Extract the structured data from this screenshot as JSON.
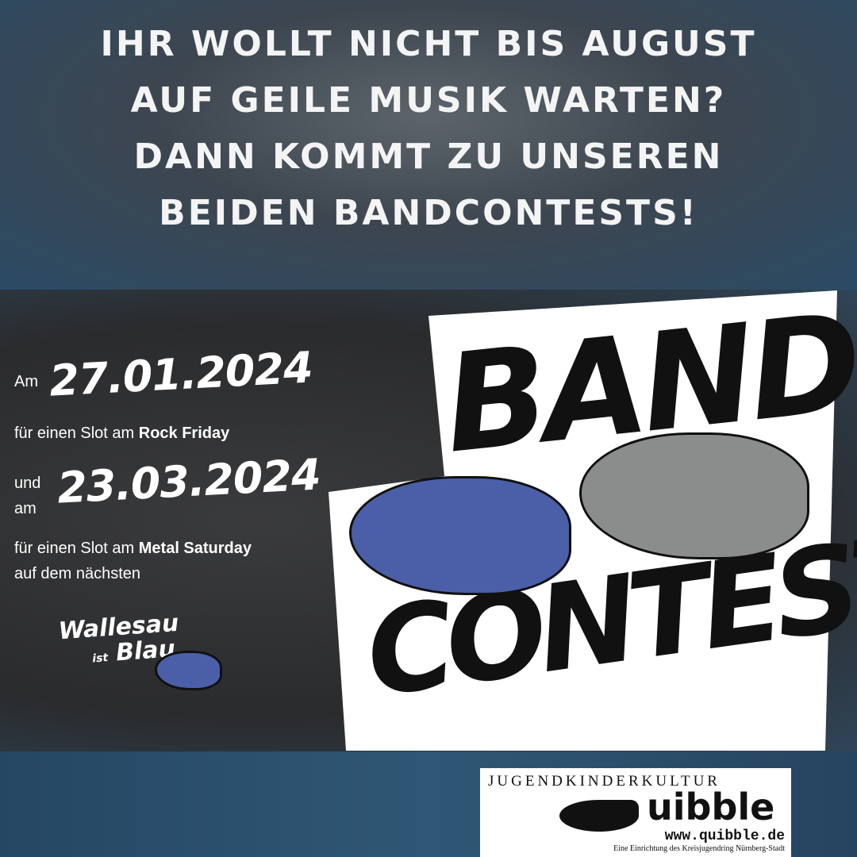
{
  "headline": [
    "Ihr wollt nicht bis August",
    "auf geile Musik warten?",
    "Dann kommt zu unseren",
    "beiden Bandcontests!"
  ],
  "event1": {
    "prefix": "Am",
    "date": "27.01.2024",
    "line_pre": "für einen Slot am ",
    "line_bold": "Rock Friday"
  },
  "event2": {
    "prefix1": "und",
    "prefix2": "am",
    "date": "23.03.2024",
    "line_pre": "für einen Slot am ",
    "line_bold": "Metal Saturday",
    "line2": "auf dem nächsten"
  },
  "festival_logo": {
    "line1": "Wallesau",
    "small": "ist",
    "line2": "Blau"
  },
  "title": {
    "word1": "BAND",
    "word2": "CONTEST"
  },
  "sponsor": {
    "top": "JUGENDKINDERKULTUR",
    "name": "uibble",
    "url": "www.quibble.de",
    "tagline": "Eine Einrichtung des Kreisjugendring Nürnberg-Stadt"
  },
  "colors": {
    "blue_boar": "#4a5fa8",
    "grey_boar": "#8a8d8c"
  }
}
